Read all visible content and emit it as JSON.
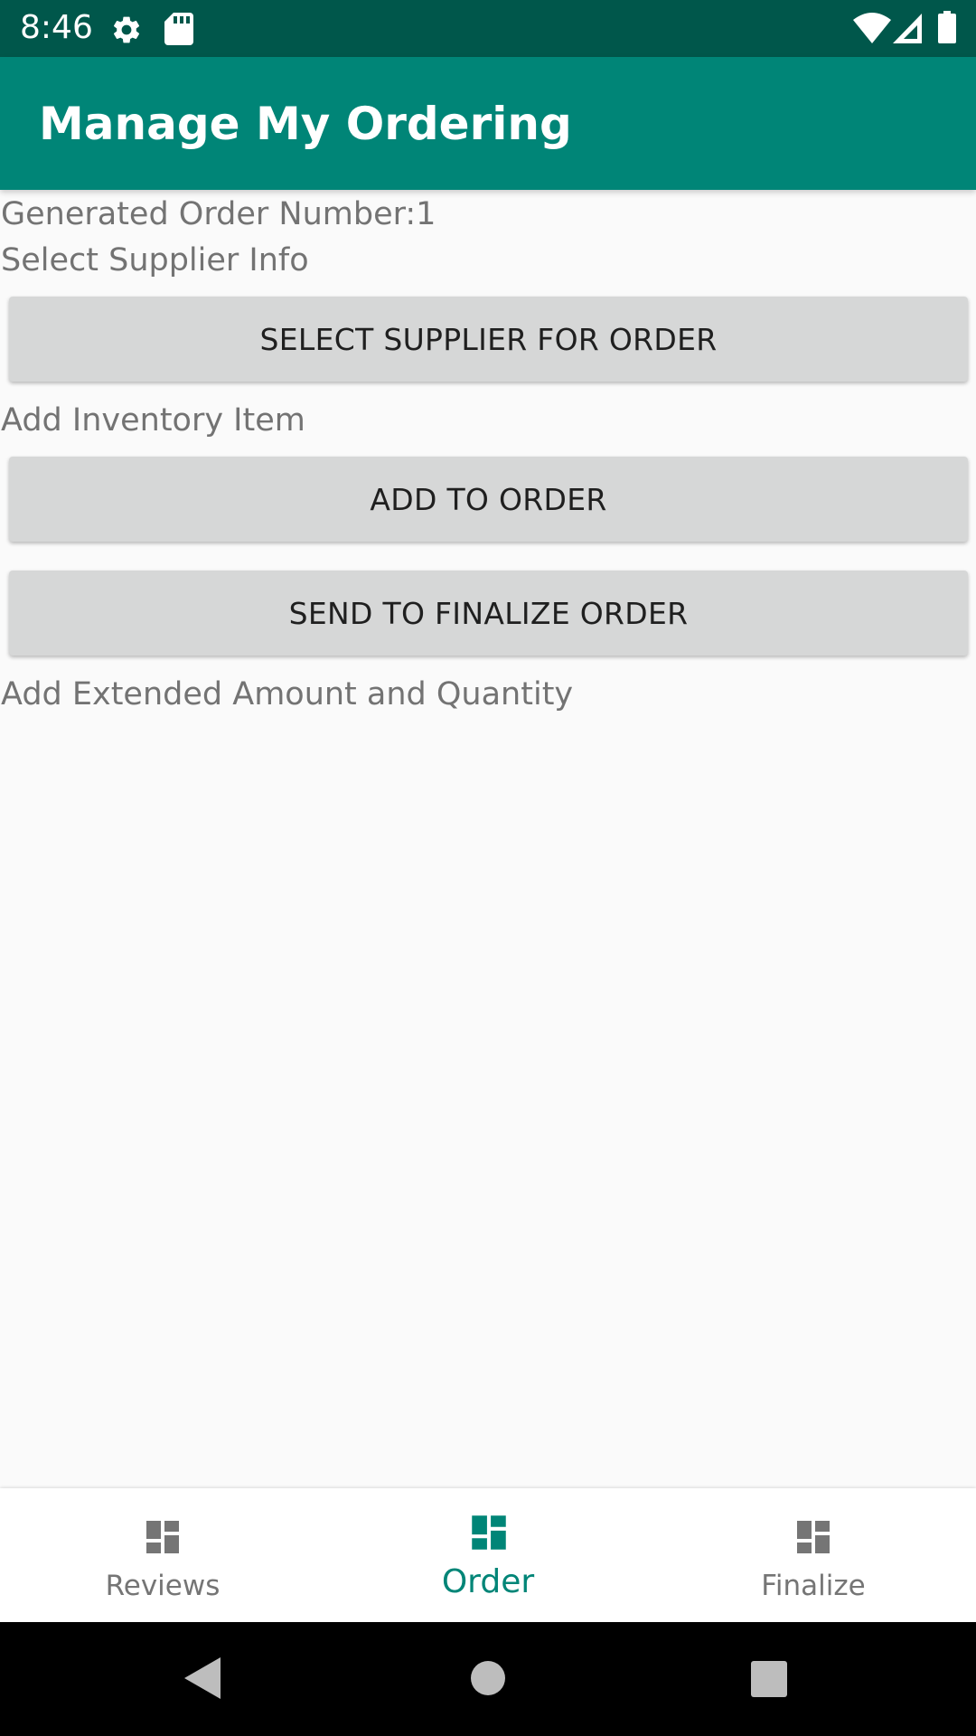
{
  "status_bar": {
    "time": "8:46",
    "icons": [
      "settings-icon",
      "sd-card-icon",
      "wifi-icon",
      "cell-signal-icon",
      "battery-icon"
    ]
  },
  "app_bar": {
    "title": "Manage My Ordering",
    "background": "#008577"
  },
  "content": {
    "order_number_label": "Generated Order Number:1",
    "supplier_section_label": "Select Supplier Info",
    "select_supplier_button": "SELECT SUPPLIER FOR ORDER",
    "inventory_section_label": "Add Inventory Item",
    "add_to_order_button": "ADD TO ORDER",
    "send_to_finalize_button": "SEND TO FINALIZE ORDER",
    "extended_amount_label": "Add Extended Amount and Quantity"
  },
  "bottom_nav": {
    "items": [
      {
        "label": "Reviews",
        "icon": "dashboard-icon",
        "active": false
      },
      {
        "label": "Order",
        "icon": "dashboard-icon",
        "active": true
      },
      {
        "label": "Finalize",
        "icon": "dashboard-icon",
        "active": false
      }
    ],
    "active_color": "#008577",
    "inactive_color": "#757575"
  },
  "system_nav": {
    "buttons": [
      "back-icon",
      "home-icon",
      "recents-icon"
    ]
  }
}
